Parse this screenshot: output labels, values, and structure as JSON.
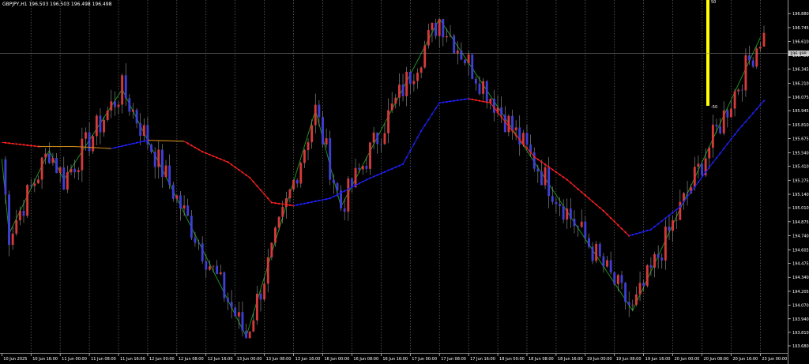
{
  "header": {
    "title": "GBPJPY,H1  196.503 196.503 196.498 196.498"
  },
  "colors": {
    "background": "#000000",
    "bull_candle": "#d63a3a",
    "bear_candle": "#3f3fd6",
    "wick": "#9a9a9a",
    "zigzag": "#1f9e1f",
    "ma_down": "#ff2020",
    "ma_up": "#2020ff",
    "ma_flat": "#d48a1a",
    "indicator_bar": "#ffff00",
    "price_line": "#808080",
    "grid": "#7a7a7a"
  },
  "chart_data": {
    "type": "candlestick",
    "symbol": "GBPJPY",
    "timeframe": "H1",
    "current_price": "196.498",
    "ylim": [
      193.68,
      196.95
    ],
    "y_ticks": [
      "196.880",
      "196.745",
      "196.610",
      "196.480",
      "196.345",
      "196.210",
      "196.075",
      "195.945",
      "195.810",
      "195.675",
      "195.540",
      "195.410",
      "195.275",
      "195.140",
      "195.010",
      "194.875",
      "194.740",
      "194.605",
      "194.475",
      "194.340",
      "194.205",
      "194.070",
      "193.940",
      "193.810",
      "193.680"
    ],
    "x_ticks": [
      "10 Jun 2025",
      "10 Jun 16:00",
      "11 Jun 00:00",
      "11 Jun 08:00",
      "11 Jun 16:00",
      "12 Jun 00:00",
      "12 Jun 08:00",
      "12 Jun 16:00",
      "13 Jun 00:00",
      "13 Jun 08:00",
      "13 Jun 16:00",
      "16 Jun 00:00",
      "16 Jun 08:00",
      "16 Jun 16:00",
      "17 Jun 00:00",
      "17 Jun 08:00",
      "17 Jun 16:00",
      "18 Jun 00:00",
      "18 Jun 08:00",
      "18 Jun 16:00",
      "19 Jun 00:00",
      "19 Jun 08:00",
      "19 Jun 16:00",
      "20 Jun 00:00",
      "20 Jun 08:00",
      "20 Jun 16:00",
      "23 Jun 00:00"
    ],
    "zigzag": [
      [
        0,
        195.48
      ],
      [
        2,
        194.76
      ],
      [
        13,
        195.56
      ],
      [
        17,
        195.28
      ],
      [
        33,
        196.15
      ],
      [
        67,
        193.77
      ],
      [
        86,
        195.95
      ],
      [
        93,
        195.02
      ],
      [
        120,
        196.83
      ],
      [
        173,
        194.02
      ],
      [
        208,
        196.65
      ]
    ],
    "ma": [
      [
        0,
        195.64
      ],
      [
        10,
        195.6
      ],
      [
        20,
        195.6
      ],
      [
        30,
        195.58
      ],
      [
        40,
        195.66
      ],
      [
        50,
        195.65
      ],
      [
        55,
        195.55
      ],
      [
        62,
        195.45
      ],
      [
        68,
        195.3
      ],
      [
        74,
        195.06
      ],
      [
        80,
        195.03
      ],
      [
        90,
        195.1
      ],
      [
        100,
        195.28
      ],
      [
        110,
        195.43
      ],
      [
        115,
        195.75
      ],
      [
        120,
        196.02
      ],
      [
        128,
        196.06
      ],
      [
        134,
        196.02
      ],
      [
        140,
        195.75
      ],
      [
        146,
        195.5
      ],
      [
        155,
        195.28
      ],
      [
        165,
        194.98
      ],
      [
        172,
        194.74
      ],
      [
        178,
        194.8
      ],
      [
        186,
        195.02
      ],
      [
        194,
        195.4
      ],
      [
        202,
        195.76
      ],
      [
        210,
        196.08
      ]
    ],
    "indicator": {
      "value_top": "50",
      "value_bottom": "-50"
    },
    "high": 196.83,
    "low": 193.77
  }
}
